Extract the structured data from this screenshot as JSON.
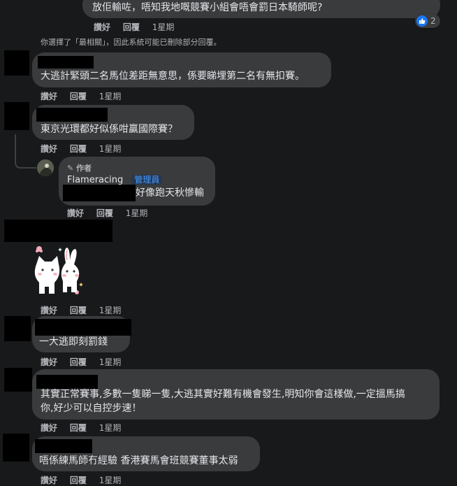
{
  "actions": {
    "like": "讚好",
    "reply": "回覆"
  },
  "notice": "你選擇了「最相關」，因此系統可能已刪除部分回覆。",
  "comments": [
    {
      "text": "放佢輸咗，唔知我地嘅競賽小組會唔會罰日本騎師呢?",
      "time": "1星期",
      "reaction_count": "2"
    },
    {
      "text": "大逃計緊頭二名馬位差距無意思，係要睇埋第二名有無扣賽。",
      "time": "1星期"
    },
    {
      "text": "東京光環都好似係咁贏國際賽？",
      "time": "1星期"
    },
    {
      "author_tag": "作者",
      "author": "Flameracing",
      "role": "管理員",
      "text": "好像跑天秋慘輸",
      "time": "1星期"
    },
    {
      "time": "1星期"
    },
    {
      "text": "一大逃即刻罰錢",
      "time": "1星期"
    },
    {
      "text_line1": "其實正常賽事,多數一隻睇一隻,大逃其實好難有機會發生,明知你會這樣做,一定搵馬搞",
      "text_line2": "你,好少可以自控步速！",
      "time": "1星期"
    },
    {
      "text": "唔係練馬師冇經驗 香港賽馬會班競賽董事太弱",
      "time": "1星期"
    }
  ],
  "icons": {
    "like": "thumbs-up-icon",
    "pencil": "pencil-icon",
    "sticker": "cat-bunny-sticker"
  },
  "colors": {
    "background": "#18191a",
    "bubble": "#3a3b3c",
    "text": "#e4e6eb",
    "muted": "#b0b3b8",
    "like": "#1877f2",
    "admin_badge": "#4599ff"
  }
}
